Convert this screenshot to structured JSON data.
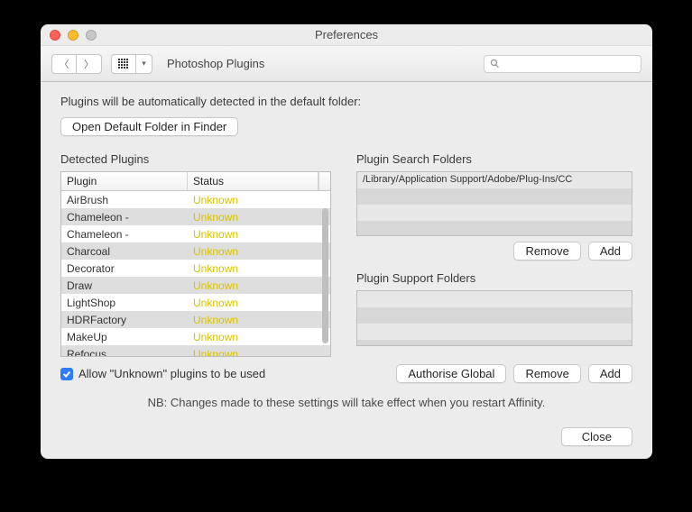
{
  "window": {
    "title": "Preferences"
  },
  "toolbar": {
    "section": "Photoshop Plugins",
    "search_placeholder": ""
  },
  "intro": "Plugins will be automatically detected in the default folder:",
  "open_folder_btn": "Open Default Folder in Finder",
  "detected": {
    "heading": "Detected Plugins",
    "col_plugin": "Plugin",
    "col_status": "Status",
    "rows": [
      {
        "plugin": "AirBrush",
        "status": "Unknown"
      },
      {
        "plugin": "Chameleon -",
        "status": "Unknown"
      },
      {
        "plugin": "Chameleon -",
        "status": "Unknown"
      },
      {
        "plugin": "Charcoal",
        "status": "Unknown"
      },
      {
        "plugin": "Decorator",
        "status": "Unknown"
      },
      {
        "plugin": "Draw",
        "status": "Unknown"
      },
      {
        "plugin": "LightShop",
        "status": "Unknown"
      },
      {
        "plugin": "HDRFactory",
        "status": "Unknown"
      },
      {
        "plugin": "MakeUp",
        "status": "Unknown"
      },
      {
        "plugin": "Refocus",
        "status": "Unknown"
      }
    ]
  },
  "search_folders": {
    "heading": "Plugin Search Folders",
    "paths": [
      "/Library/Application Support/Adobe/Plug-Ins/CC"
    ],
    "remove": "Remove",
    "add": "Add"
  },
  "support_folders": {
    "heading": "Plugin Support Folders",
    "paths": [],
    "authorise": "Authorise Global",
    "remove": "Remove",
    "add": "Add"
  },
  "allow_unknown": {
    "checked": true,
    "label": "Allow \"Unknown\" plugins to be used"
  },
  "restart_note": "NB: Changes made to these settings will take effect when you restart Affinity.",
  "close": "Close"
}
